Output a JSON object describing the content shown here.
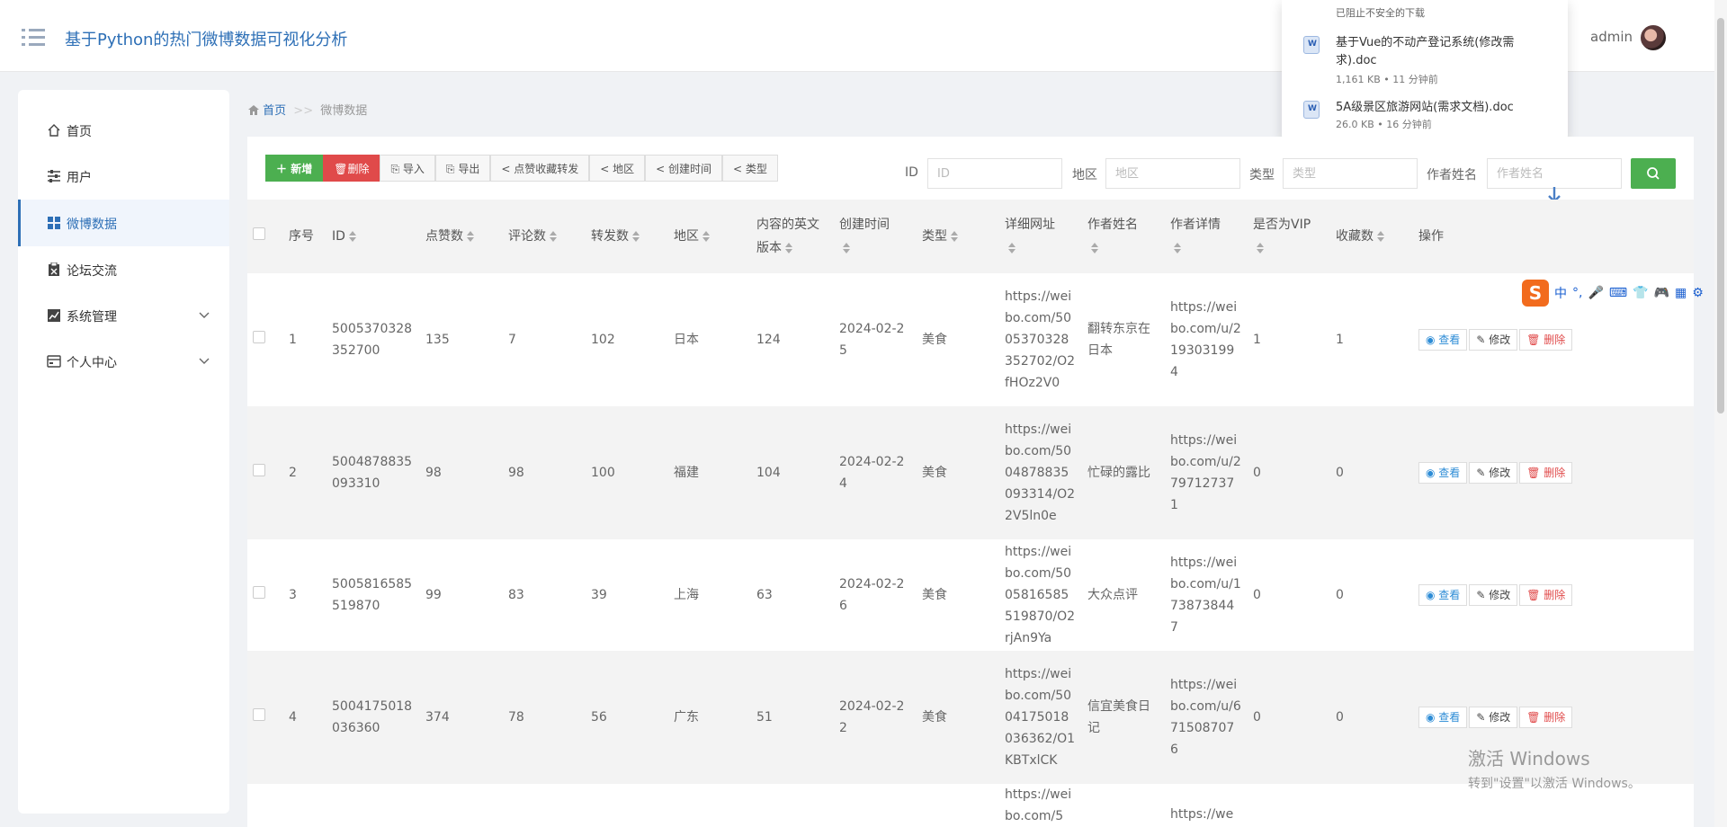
{
  "header": {
    "title": "基于Python的热门微博数据可视化分析",
    "username": "admin"
  },
  "download_popup": {
    "warning": "已阻止不安全的下载",
    "items": [
      {
        "name": "基于Vue的不动产登记系统(修改需求).doc",
        "meta": "1,161 KB • 11 分钟前"
      },
      {
        "name": "5A级景区旅游网站(需求文档).doc",
        "meta": "26.0 KB • 16 分钟前"
      }
    ]
  },
  "sidebar": {
    "items": [
      {
        "label": "首页",
        "icon": "home-icon"
      },
      {
        "label": "用户",
        "icon": "sliders-icon"
      },
      {
        "label": "微博数据",
        "icon": "grid-icon",
        "active": true
      },
      {
        "label": "论坛交流",
        "icon": "clipboard-icon"
      },
      {
        "label": "系统管理",
        "icon": "chart-icon",
        "expandable": true
      },
      {
        "label": "个人中心",
        "icon": "card-icon",
        "expandable": true
      }
    ]
  },
  "breadcrumb": {
    "home": "首页",
    "separator": ">>",
    "current": "微博数据"
  },
  "toolbar": {
    "buttons": [
      "新增",
      "删除",
      "导入",
      "导出",
      "点赞收藏转发",
      "地区",
      "创建时间",
      "类型"
    ]
  },
  "filters": [
    {
      "label": "ID",
      "placeholder": "ID"
    },
    {
      "label": "地区",
      "placeholder": "地区"
    },
    {
      "label": "类型",
      "placeholder": "类型"
    },
    {
      "label": "作者姓名",
      "placeholder": "作者姓名"
    }
  ],
  "table": {
    "headers": [
      "序号",
      "ID",
      "点赞数",
      "评论数",
      "转发数",
      "地区",
      "内容的英文版本",
      "创建时间",
      "类型",
      "详细网址",
      "作者姓名",
      "作者详情",
      "是否为VIP",
      "收藏数",
      "操作"
    ],
    "rows": [
      {
        "seq": "1",
        "id": "5005370328352700",
        "likes": "135",
        "comments": "7",
        "reposts": "102",
        "region": "日本",
        "en": "124",
        "created": "2024-02-25",
        "type": "美食",
        "url": "https://weibo.com/5005370328352702/O2fHOz2V0",
        "author": "翻转东京在日本",
        "author_url": "https://weibo.com/u/2193031994",
        "vip": "1",
        "fav": "1"
      },
      {
        "seq": "2",
        "id": "5004878835093310",
        "likes": "98",
        "comments": "98",
        "reposts": "100",
        "region": "福建",
        "en": "104",
        "created": "2024-02-24",
        "type": "美食",
        "url": "https://weibo.com/5004878835093314/O22V5ln0e",
        "author": "忙碌的露比",
        "author_url": "https://weibo.com/u/2797127371",
        "vip": "0",
        "fav": "0"
      },
      {
        "seq": "3",
        "id": "5005816585519870",
        "likes": "99",
        "comments": "83",
        "reposts": "39",
        "region": "上海",
        "en": "63",
        "created": "2024-02-26",
        "type": "美食",
        "url": "https://weibo.com/5005816585519870/O2rjAn9Ya",
        "author": "大众点评",
        "author_url": "https://weibo.com/u/1738738447",
        "vip": "0",
        "fav": "0"
      },
      {
        "seq": "4",
        "id": "5004175018036360",
        "likes": "374",
        "comments": "78",
        "reposts": "56",
        "region": "广东",
        "en": "51",
        "created": "2024-02-22",
        "type": "美食",
        "url": "https://weibo.com/5004175018036362/O1KBTxlCK",
        "author": "信宜美食日记",
        "author_url": "https://weibo.com/u/6715087076",
        "vip": "0",
        "fav": "0"
      },
      {
        "seq": "",
        "id": "",
        "likes": "",
        "comments": "",
        "reposts": "",
        "region": "",
        "en": "",
        "created": "",
        "type": "",
        "url": "https://weibo.com/5",
        "author": "",
        "author_url": "https://we",
        "vip": "",
        "fav": ""
      }
    ],
    "actions": {
      "view": "查看",
      "edit": "修改",
      "delete": "删除"
    }
  },
  "watermark": {
    "line1": "激活 Windows",
    "line2": "转到\"设置\"以激活 Windows。"
  },
  "ime": {
    "mode": "中",
    "punct": "°,"
  },
  "colors": {
    "accent": "#2d6fb6",
    "green": "#4caf50",
    "red": "#e04a4a"
  }
}
